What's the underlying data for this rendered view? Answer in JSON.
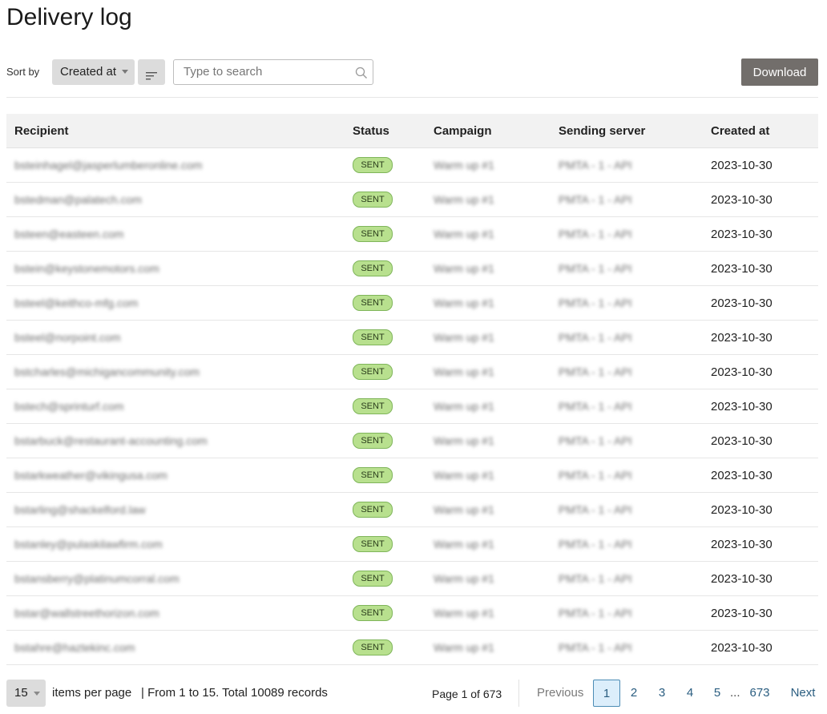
{
  "page": {
    "title": "Delivery log"
  },
  "toolbar": {
    "sort_label": "Sort by",
    "sort_value": "Created at",
    "search_placeholder": "Type to search",
    "download_label": "Download"
  },
  "table": {
    "columns": [
      "Recipient",
      "Status",
      "Campaign",
      "Sending server",
      "Created at"
    ],
    "rows": [
      {
        "recipient": "bsteinhagel@jasperlumberonline.com",
        "status": "SENT",
        "campaign": "Warm up #1",
        "server": "PMTA - 1 - API",
        "created_at": "2023-10-30"
      },
      {
        "recipient": "bstedman@palatech.com",
        "status": "SENT",
        "campaign": "Warm up #1",
        "server": "PMTA - 1 - API",
        "created_at": "2023-10-30"
      },
      {
        "recipient": "bsteen@easteen.com",
        "status": "SENT",
        "campaign": "Warm up #1",
        "server": "PMTA - 1 - API",
        "created_at": "2023-10-30"
      },
      {
        "recipient": "bstein@keystonemotors.com",
        "status": "SENT",
        "campaign": "Warm up #1",
        "server": "PMTA - 1 - API",
        "created_at": "2023-10-30"
      },
      {
        "recipient": "bsteel@keithco-mfg.com",
        "status": "SENT",
        "campaign": "Warm up #1",
        "server": "PMTA - 1 - API",
        "created_at": "2023-10-30"
      },
      {
        "recipient": "bsteel@norpoint.com",
        "status": "SENT",
        "campaign": "Warm up #1",
        "server": "PMTA - 1 - API",
        "created_at": "2023-10-30"
      },
      {
        "recipient": "bstcharles@michigancommunity.com",
        "status": "SENT",
        "campaign": "Warm up #1",
        "server": "PMTA - 1 - API",
        "created_at": "2023-10-30"
      },
      {
        "recipient": "bstech@sprinturf.com",
        "status": "SENT",
        "campaign": "Warm up #1",
        "server": "PMTA - 1 - API",
        "created_at": "2023-10-30"
      },
      {
        "recipient": "bstarbuck@restaurant-accounting.com",
        "status": "SENT",
        "campaign": "Warm up #1",
        "server": "PMTA - 1 - API",
        "created_at": "2023-10-30"
      },
      {
        "recipient": "bstarkweather@vikingusa.com",
        "status": "SENT",
        "campaign": "Warm up #1",
        "server": "PMTA - 1 - API",
        "created_at": "2023-10-30"
      },
      {
        "recipient": "bstarling@shackelford.law",
        "status": "SENT",
        "campaign": "Warm up #1",
        "server": "PMTA - 1 - API",
        "created_at": "2023-10-30"
      },
      {
        "recipient": "bstanley@pulaskilawfirm.com",
        "status": "SENT",
        "campaign": "Warm up #1",
        "server": "PMTA - 1 - API",
        "created_at": "2023-10-30"
      },
      {
        "recipient": "bstansberry@platinumcorral.com",
        "status": "SENT",
        "campaign": "Warm up #1",
        "server": "PMTA - 1 - API",
        "created_at": "2023-10-30"
      },
      {
        "recipient": "bstar@wallstreethorizon.com",
        "status": "SENT",
        "campaign": "Warm up #1",
        "server": "PMTA - 1 - API",
        "created_at": "2023-10-30"
      },
      {
        "recipient": "bstahre@haztekinc.com",
        "status": "SENT",
        "campaign": "Warm up #1",
        "server": "PMTA - 1 - API",
        "created_at": "2023-10-30"
      }
    ]
  },
  "footer": {
    "per_page_value": "15",
    "per_page_label": "items per page",
    "records_summary": "| From 1 to 15. Total 10089 records",
    "page_indicator": "Page 1 of 673",
    "previous_label": "Previous",
    "pages": [
      "1",
      "2",
      "3",
      "4",
      "5"
    ],
    "ellipsis": "...",
    "last_page": "673",
    "next_label": "Next"
  }
}
